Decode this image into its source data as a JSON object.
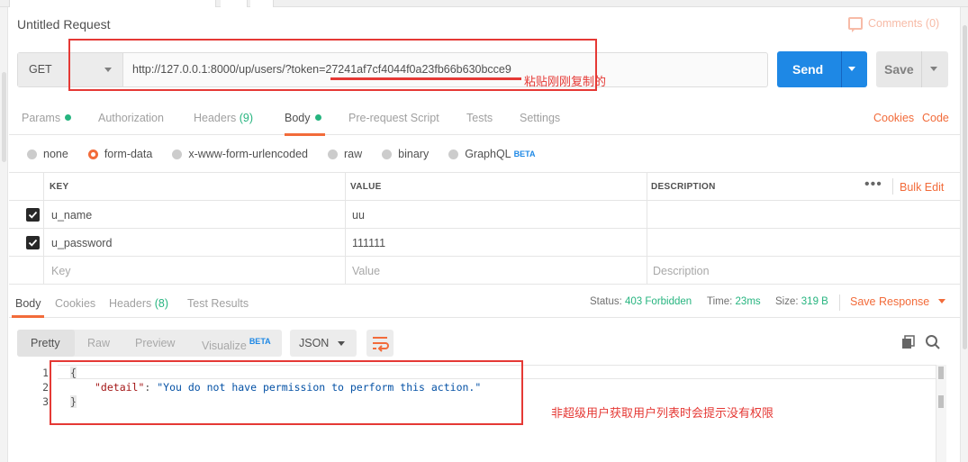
{
  "request": {
    "title": "Untitled Request",
    "comments_label": "Comments (0)",
    "method": "GET",
    "url": "http://127.0.0.1:8000/up/users/?token=27241af7cf4044f0a23fb66b630bcce9",
    "send_label": "Send",
    "save_label": "Save"
  },
  "annotations": {
    "url_note": "粘贴刚刚复制的",
    "response_note": "非超级用户获取用户列表时会提示没有权限",
    "color": "#e53935"
  },
  "req_tabs": {
    "params": "Params",
    "authorization": "Authorization",
    "headers": "Headers",
    "headers_count": "(9)",
    "body": "Body",
    "pre_request": "Pre-request Script",
    "tests": "Tests",
    "settings": "Settings",
    "cookies": "Cookies",
    "code": "Code"
  },
  "body_types": {
    "none": "none",
    "form_data": "form-data",
    "urlencoded": "x-www-form-urlencoded",
    "raw": "raw",
    "binary": "binary",
    "graphql": "GraphQL",
    "beta": "BETA",
    "selected": "form-data"
  },
  "params_table": {
    "headers": {
      "key": "KEY",
      "value": "VALUE",
      "description": "DESCRIPTION",
      "more": "•••",
      "bulk_edit": "Bulk Edit"
    },
    "rows": [
      {
        "checked": true,
        "key": "u_name",
        "value": "uu",
        "description": ""
      },
      {
        "checked": true,
        "key": "u_password",
        "value": "111111",
        "description": ""
      }
    ],
    "placeholder": {
      "key": "Key",
      "value": "Value",
      "description": "Description"
    }
  },
  "response": {
    "tabs": {
      "body": "Body",
      "cookies": "Cookies",
      "headers": "Headers",
      "headers_count": "(8)",
      "test_results": "Test Results"
    },
    "status_label": "Status:",
    "status_value": "403 Forbidden",
    "time_label": "Time:",
    "time_value": "23ms",
    "size_label": "Size:",
    "size_value": "319 B",
    "save_response": "Save Response",
    "views": {
      "pretty": "Pretty",
      "raw": "Raw",
      "preview": "Preview",
      "visualize": "Visualize",
      "beta": "BETA"
    },
    "format": "JSON",
    "lines": [
      "1",
      "2",
      "3"
    ],
    "code": {
      "open": "{",
      "key": "\"detail\"",
      "colon": ": ",
      "value": "\"You do not have permission to perform this action.\"",
      "close": "}"
    }
  },
  "colors": {
    "accent": "#f26b3a",
    "send_blue": "#1e88e5",
    "status_green": "#26b47f"
  }
}
